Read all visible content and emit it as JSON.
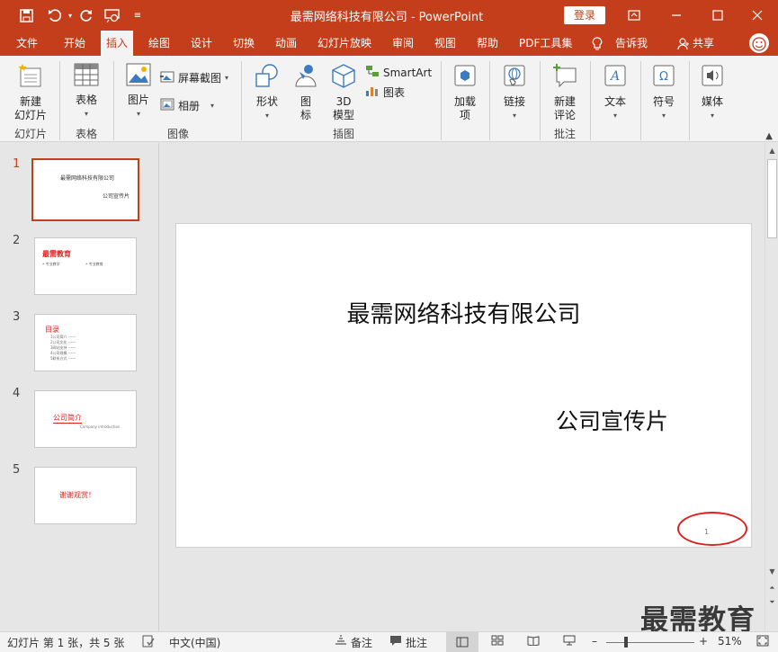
{
  "title_bar": {
    "document_title": "最需网络科技有限公司 - PowerPoint",
    "login_label": "登录"
  },
  "tabs": [
    {
      "label": "文件"
    },
    {
      "label": "开始"
    },
    {
      "label": "插入"
    },
    {
      "label": "绘图"
    },
    {
      "label": "设计"
    },
    {
      "label": "切换"
    },
    {
      "label": "动画"
    },
    {
      "label": "幻灯片放映"
    },
    {
      "label": "审阅"
    },
    {
      "label": "视图"
    },
    {
      "label": "帮助"
    },
    {
      "label": "PDF工具集"
    },
    {
      "label": "告诉我"
    },
    {
      "label": "共享"
    }
  ],
  "active_tab": "插入",
  "ribbon": {
    "new_slide": "新建\n幻灯片",
    "table": "表格",
    "picture": "图片",
    "screenshot": "屏幕截图",
    "album": "相册",
    "shapes": "形状",
    "icons": "图\n标",
    "model_3d": "3D\n模型",
    "smartart": "SmartArt",
    "chart": "图表",
    "addins": "加载\n项",
    "link": "链接",
    "new_comment": "新建\n评论",
    "text": "文本",
    "symbol": "符号",
    "media": "媒体",
    "groups": {
      "slides": "幻灯片",
      "tables": "表格",
      "images": "图像",
      "illustrations": "插图",
      "comments": "批注"
    }
  },
  "thumbnails": [
    {
      "number": "1",
      "title": "最需网络科技有限公司",
      "subtitle": "公司宣传片"
    },
    {
      "number": "2",
      "title": "最需教育",
      "item_a": "• 专业教学",
      "item_b": "• 专业教育"
    },
    {
      "number": "3",
      "title": "目录",
      "lines": [
        "1公司简介 ------",
        "2公司文化 ------",
        "3网站支持 ------",
        "4公司规模 ------",
        "5联系方式 ------"
      ]
    },
    {
      "number": "4",
      "title": "公司简介",
      "subtitle": "Company introduction"
    },
    {
      "number": "5",
      "title": "谢谢观赏！"
    }
  ],
  "slide": {
    "title": "最需网络科技有限公司",
    "subtitle": "公司宣传片",
    "page_number": "1"
  },
  "status_bar": {
    "slide_info": "幻灯片 第 1 张，共 5 张",
    "language": "中文(中国)",
    "notes": "备注",
    "comments": "批注",
    "zoom": "51%"
  },
  "watermark": "最需教育",
  "colors": {
    "accent": "#c43e1c",
    "ellipse": "#e02020",
    "thumb_title_red": "#e02020"
  }
}
